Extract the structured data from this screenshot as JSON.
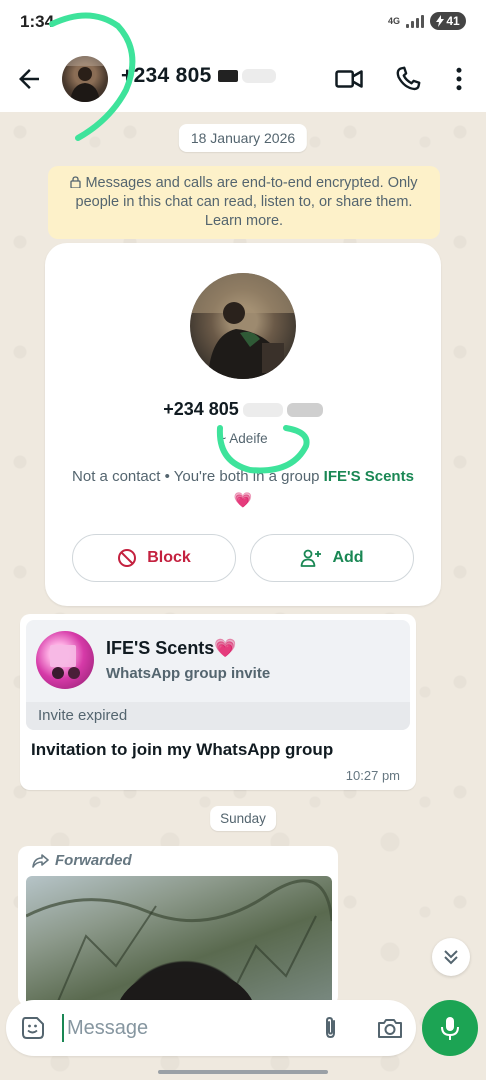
{
  "status_bar": {
    "time": "1:34",
    "network": "4G",
    "battery": "41"
  },
  "header": {
    "contact_number": "+234 805"
  },
  "chat": {
    "date_chip": "18 January 2026",
    "encryption_notice": "Messages and calls are end-to-end encrypted. Only people in this chat can read, listen to, or share them. Learn more.",
    "contact_card": {
      "phone": "+234 805",
      "push_name": "~ Adeife",
      "info_prefix": "Not a contact • You're both in a group ",
      "group_name": "IFE'S Scents💗",
      "block_label": "Block",
      "add_label": "Add"
    },
    "invite_message": {
      "group_title": "IFE'S Scents💗",
      "subtitle": "WhatsApp group invite",
      "status": "Invite expired",
      "text": "Invitation to join my WhatsApp group",
      "time": "10:27 pm"
    },
    "day_chip": "Sunday",
    "forwarded_message": {
      "label": "Forwarded"
    }
  },
  "composer": {
    "placeholder": "Message"
  },
  "colors": {
    "accent_green": "#1a8754",
    "block_red": "#c4213f",
    "mic_green": "#1ca454",
    "annotation_green": "#3ee39b"
  }
}
